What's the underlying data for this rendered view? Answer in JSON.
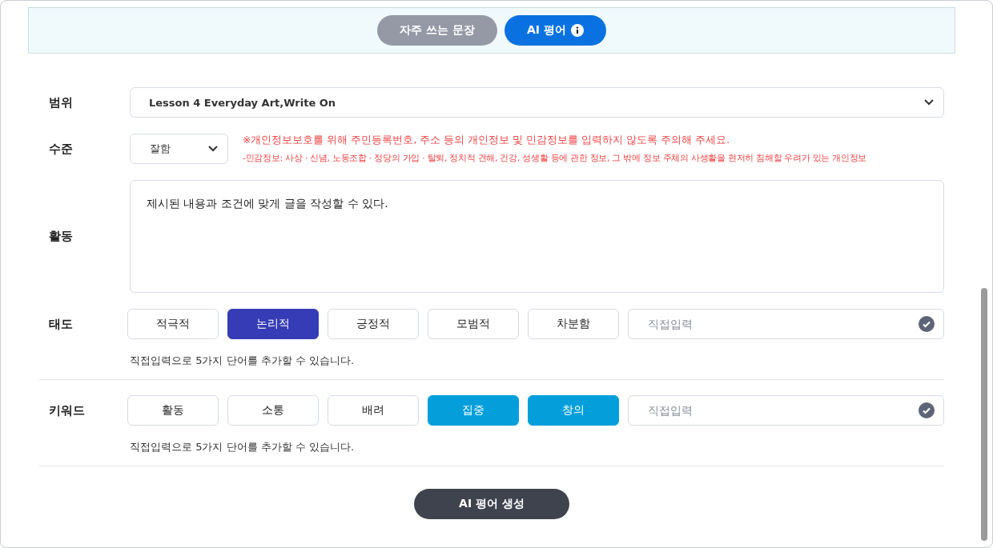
{
  "tabs": [
    {
      "label": "자주 쓰는 문장",
      "selected": false,
      "info": false
    },
    {
      "label": "AI 평어",
      "selected": true,
      "info": true
    }
  ],
  "scope": {
    "label": "범위",
    "value": "Lesson 4 Everyday Art,Write On"
  },
  "level": {
    "label": "수준",
    "value": "잘함",
    "notice": "※개인정보보호를 위해 주민등록번호, 주소 등의 개인정보 및 민감정보를 입력하지 않도록 주의해 주세요.",
    "detail": "-민감정보: 사상 · 신념, 노동조합 · 정당의 가입 · 탈퇴, 정치적 견해, 건강, 성생활 등에 관한 정보, 그 밖에 정보 주체의 사생활을 현저히 침해할 우려가 있는 개인정보"
  },
  "activity": {
    "label": "활동",
    "value": "제시된 내용과 조건에 맞게 글을 작성할 수 있다."
  },
  "chip_groups": [
    {
      "kind": "attitude",
      "label": "태도",
      "chips": [
        {
          "label": "적극적",
          "selected": false
        },
        {
          "label": "논리적",
          "selected": true
        },
        {
          "label": "긍정적",
          "selected": false
        },
        {
          "label": "모범적",
          "selected": false
        },
        {
          "label": "차분함",
          "selected": false
        }
      ],
      "placeholder": "직접입력",
      "hint": "직접입력으로 5가지 단어를 추가할 수 있습니다."
    },
    {
      "kind": "keyword",
      "label": "키워드",
      "chips": [
        {
          "label": "활동",
          "selected": false
        },
        {
          "label": "소통",
          "selected": false
        },
        {
          "label": "배려",
          "selected": false
        },
        {
          "label": "집중",
          "selected": true
        },
        {
          "label": "창의",
          "selected": true
        }
      ],
      "placeholder": "직접입력",
      "hint": "직접입력으로 5가지 단어를 추가할 수 있습니다."
    }
  ],
  "generate_button": "AI 평어 생성"
}
